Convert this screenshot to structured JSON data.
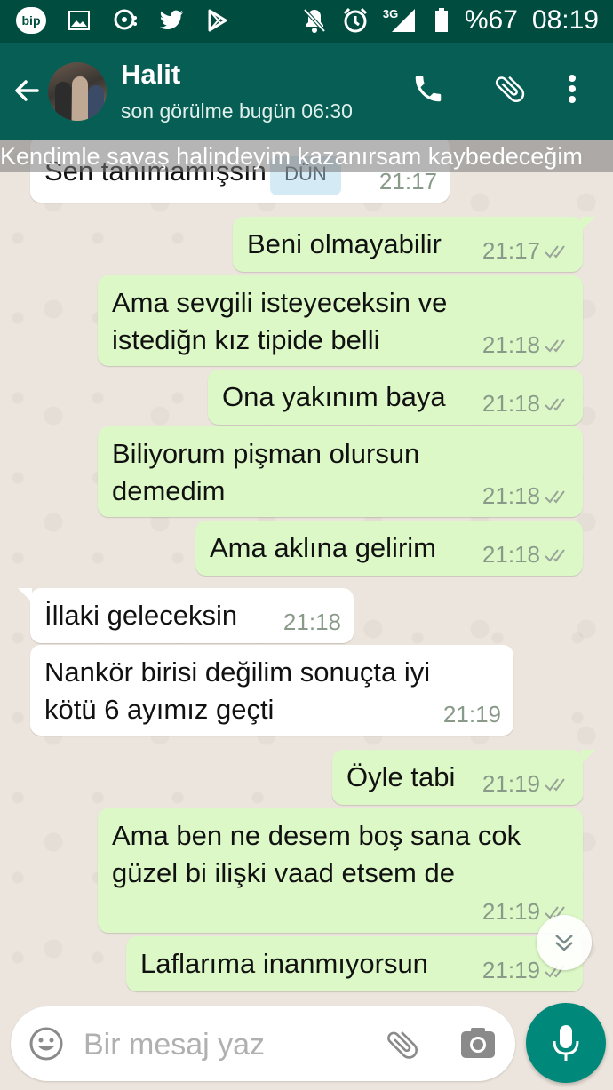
{
  "status_bar": {
    "icons_left": [
      "bip-app-icon",
      "image-icon",
      "chat-bubble-icon",
      "twitter-icon",
      "play-store-icon"
    ],
    "bip_label": "bip",
    "network": "3G",
    "battery": "%67",
    "time": "08:19"
  },
  "header": {
    "contact_name": "Halit",
    "last_seen": "son görülme bugün 06:30"
  },
  "chat": {
    "banner": "Kendimle savaş halindeyim kazanırsam kaybedeceğim",
    "date_chip": "DÜN",
    "messages": [
      {
        "dir": "in",
        "text": "Sen tanımamışsın ki",
        "time": "21:17"
      },
      {
        "dir": "out",
        "text": "Beni olmayabilir",
        "time": "21:17"
      },
      {
        "dir": "out",
        "text": "Ama sevgili isteyeceksin ve\nistediğn kız tipide belli",
        "time": "21:18"
      },
      {
        "dir": "out",
        "text": "Ona yakınım baya",
        "time": "21:18"
      },
      {
        "dir": "out",
        "text": "Biliyorum pişman olursun\ndemedim",
        "time": "21:18"
      },
      {
        "dir": "out",
        "text": "Ama aklına gelirim",
        "time": "21:18"
      },
      {
        "dir": "in",
        "text": "İllaki geleceksin",
        "time": "21:18"
      },
      {
        "dir": "in",
        "text": "Nankör birisi değilim sonuçta iyi\nkötü 6 ayımız geçti",
        "time": "21:19"
      },
      {
        "dir": "out",
        "text": "Öyle tabi",
        "time": "21:19"
      },
      {
        "dir": "out",
        "text": "Ama ben ne desem boş sana cok\ngüzel bi ilişki vaad etsem de",
        "time": "21:19"
      },
      {
        "dir": "out",
        "text": "Laflarıma inanmıyorsun",
        "time": "21:19"
      }
    ]
  },
  "composer": {
    "placeholder": "Bir mesaj yaz"
  },
  "colors": {
    "header": "#075e54",
    "status_bar": "#004d40",
    "outgoing": "#dcf8c6",
    "incoming": "#ffffff",
    "mic": "#00897b"
  }
}
